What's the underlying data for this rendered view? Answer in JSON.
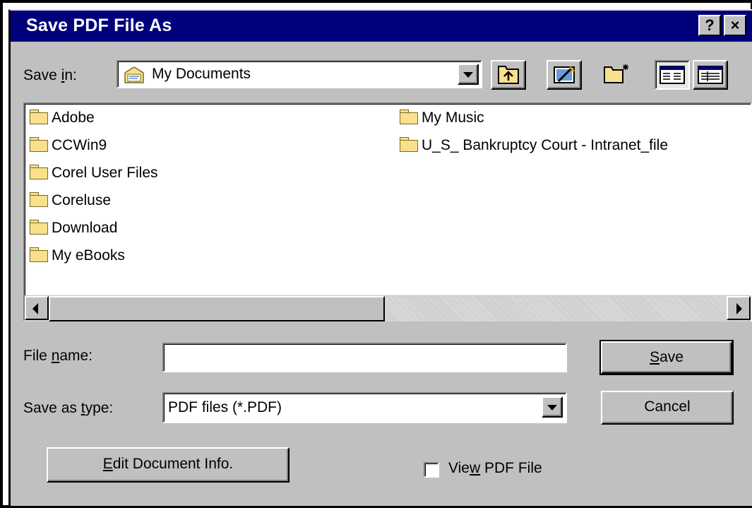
{
  "window": {
    "title": "Save PDF File As",
    "help_label": "?",
    "close_label": "×"
  },
  "save_in": {
    "label_prefix": "Save ",
    "label_hotkey": "i",
    "label_suffix": "n:",
    "value": "My Documents"
  },
  "toolbar": {
    "buttons": [
      "up-one-level",
      "desktop",
      "create-new-folder",
      "list-view",
      "details-view"
    ]
  },
  "files": {
    "column1": [
      "Adobe",
      "CCWin9",
      "Corel User Files",
      "Coreluse",
      "Download",
      "My eBooks"
    ],
    "column2": [
      "My Music",
      "U_S_ Bankruptcy Court - Intranet_file"
    ]
  },
  "file_name": {
    "label_prefix": "File ",
    "label_hotkey": "n",
    "label_suffix": "ame:",
    "value": ""
  },
  "save_as_type": {
    "label_prefix": "Save as ",
    "label_hotkey": "t",
    "label_suffix": "ype:",
    "value": "PDF files (*.PDF)"
  },
  "buttons": {
    "save_hotkey": "S",
    "save_rest": "ave",
    "cancel": "Cancel",
    "edit_hotkey": "E",
    "edit_rest": "dit Document Info."
  },
  "view_pdf": {
    "label_prefix": "Vie",
    "label_hotkey": "w",
    "label_suffix": " PDF File",
    "checked": false
  },
  "colors": {
    "titlebar": "#00007b",
    "face": "#c0c0c0",
    "folder": "#f8e08c"
  }
}
